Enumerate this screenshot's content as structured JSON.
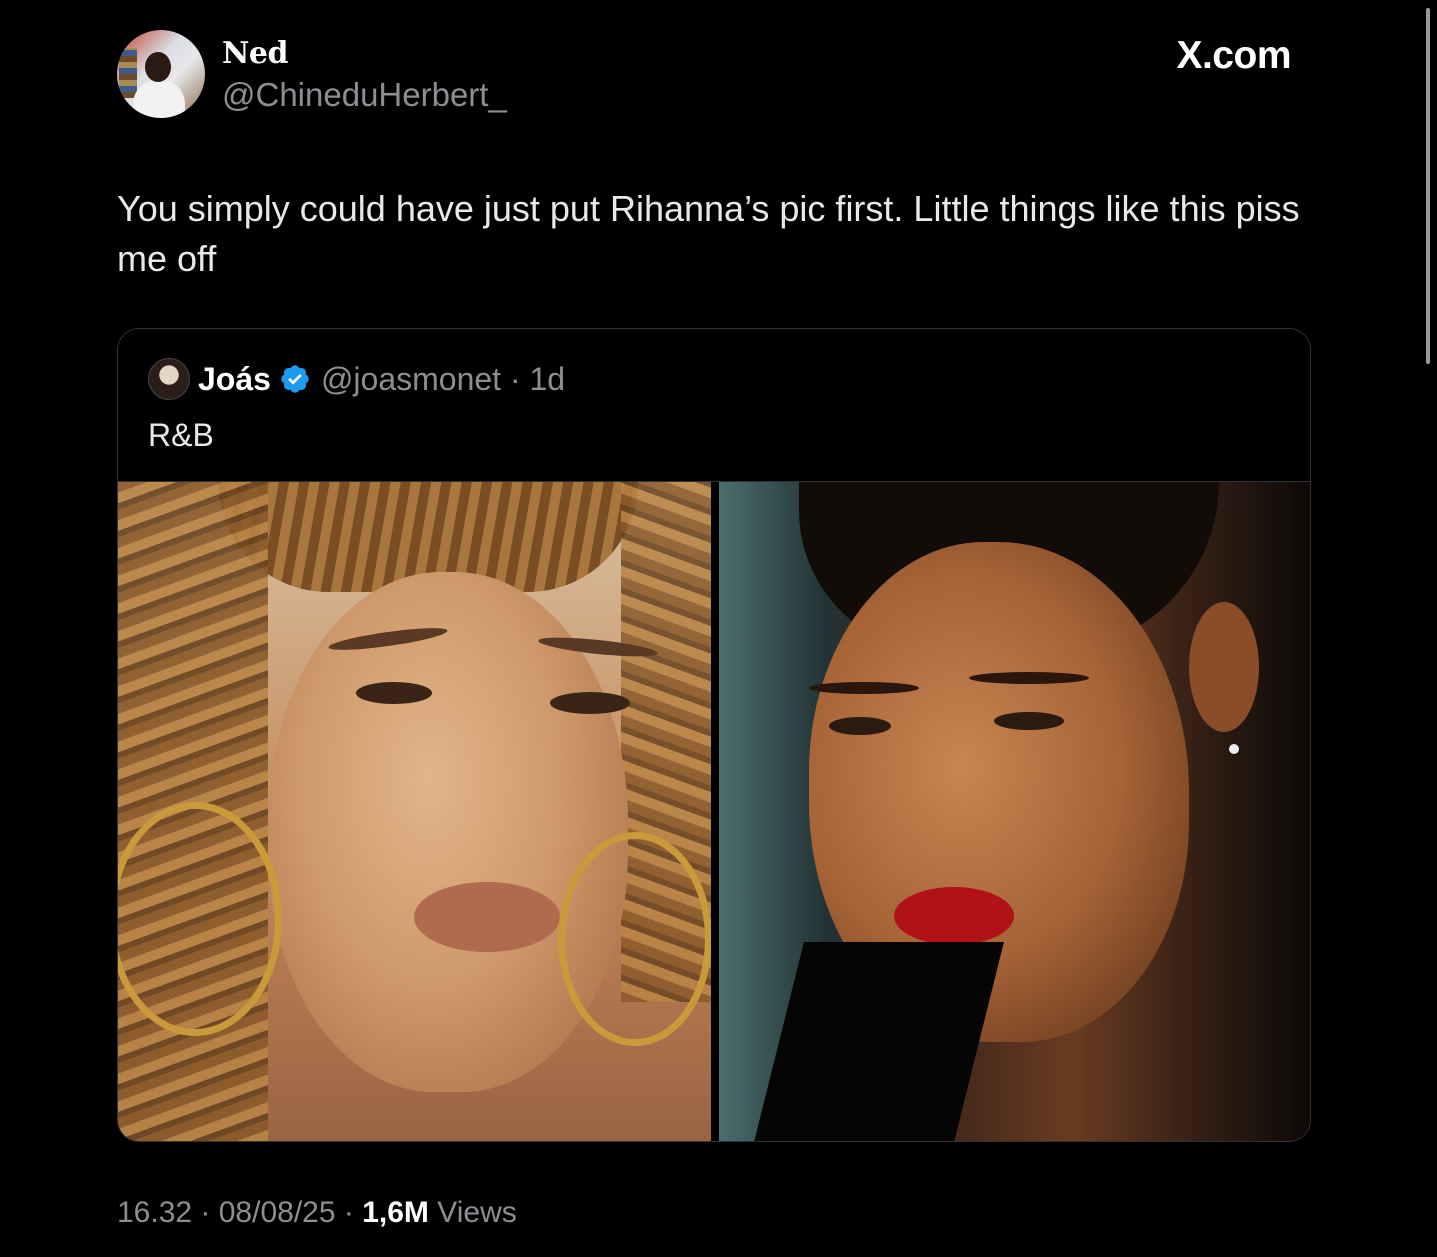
{
  "tweet": {
    "author_name": "Ned",
    "author_handle": "@ChineduHerbert_",
    "brand": "X.com",
    "text": "You simply could have just put Rihanna’s pic first. Little things like this piss me off",
    "time": "16.32",
    "date": "08/08/25",
    "views_count": "1,6M",
    "views_label": "Views"
  },
  "quote": {
    "author_name": "Joás",
    "author_handle": "@joasmonet",
    "age": "1d",
    "text": "R&B"
  },
  "colors": {
    "background": "#000000",
    "text": "#e7e9ea",
    "secondary_text": "#8b8f94",
    "verified_badge": "#1d9bf0"
  }
}
